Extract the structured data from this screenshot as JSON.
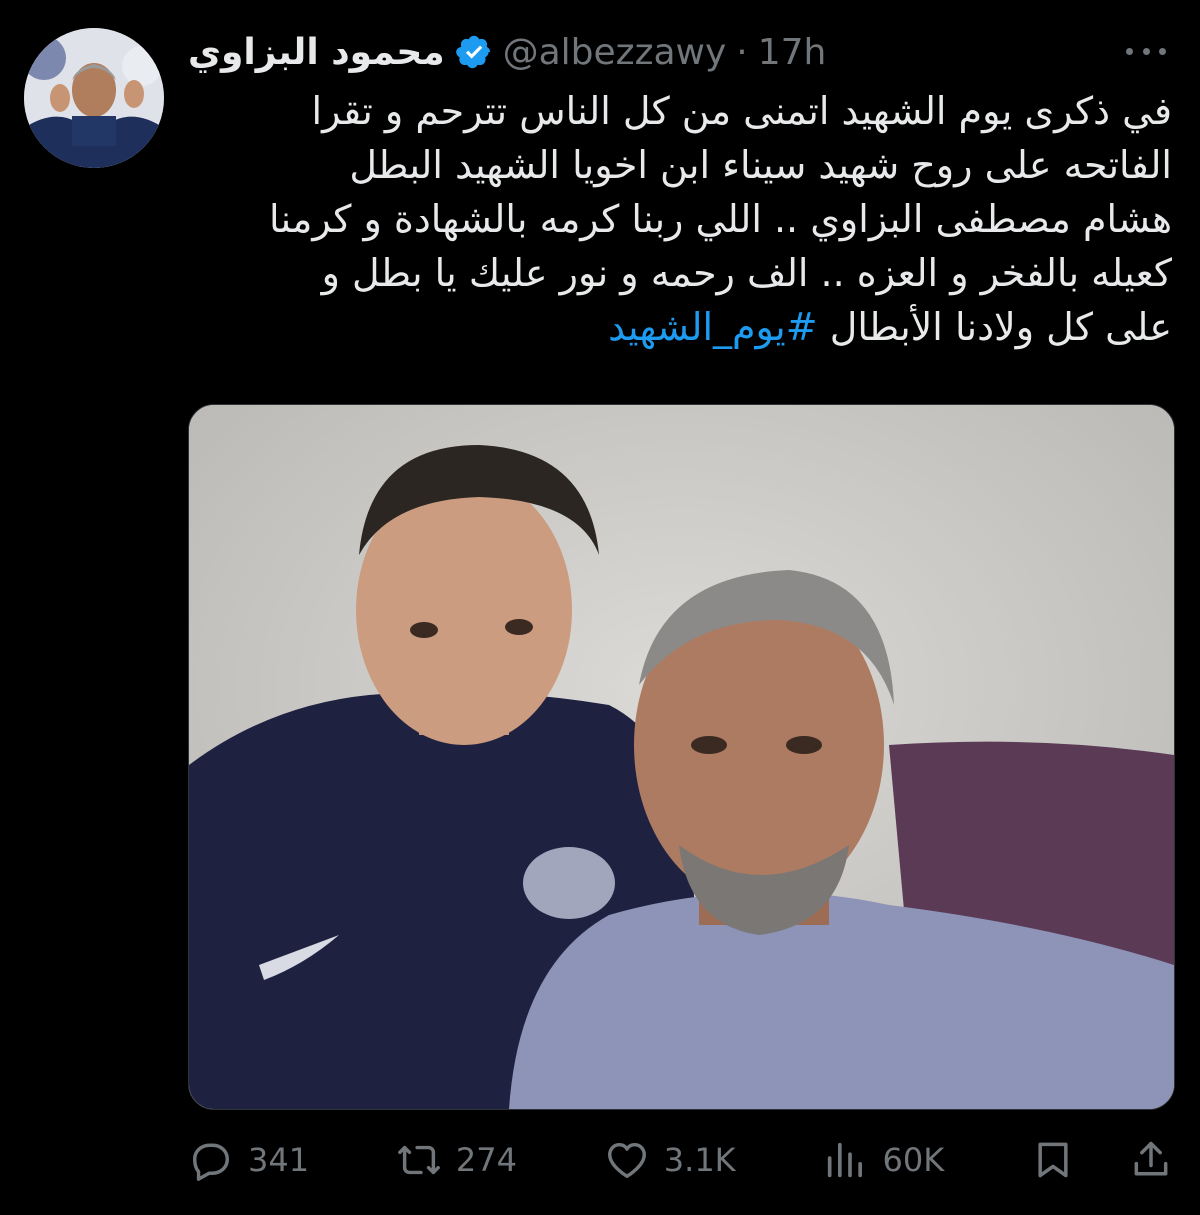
{
  "tweet": {
    "author": {
      "display_name": "محمود البزاوي",
      "handle": "@albezzawy",
      "separator": "·",
      "time": "17h",
      "verified": true
    },
    "text_lines": [
      "في ذكرى يوم الشهيد اتمنى من كل الناس تترحم و تقرا",
      "الفاتحه على روح شهيد سيناء ابن اخويا الشهيد البطل",
      "هشام مصطفى البزاوي .. اللي ربنا كرمه بالشهادة و كرمنا",
      "كعيله بالفخر و العزه .. الف رحمه و نور عليك يا بطل و",
      "على كل ولادنا الأبطال"
    ],
    "hashtag": "#يوم_الشهيد",
    "stats": {
      "replies": "341",
      "reposts": "274",
      "likes": "3.1K",
      "views": "60K"
    }
  },
  "colors": {
    "background": "#000000",
    "text": "#e7e9ea",
    "muted": "#71767b",
    "accent": "#1d9bf0"
  },
  "icons": {
    "verified": "verified-badge-icon",
    "more": "more-icon",
    "reply": "reply-icon",
    "repost": "repost-icon",
    "like": "heart-icon",
    "views": "views-icon",
    "bookmark": "bookmark-icon",
    "share": "share-icon"
  }
}
